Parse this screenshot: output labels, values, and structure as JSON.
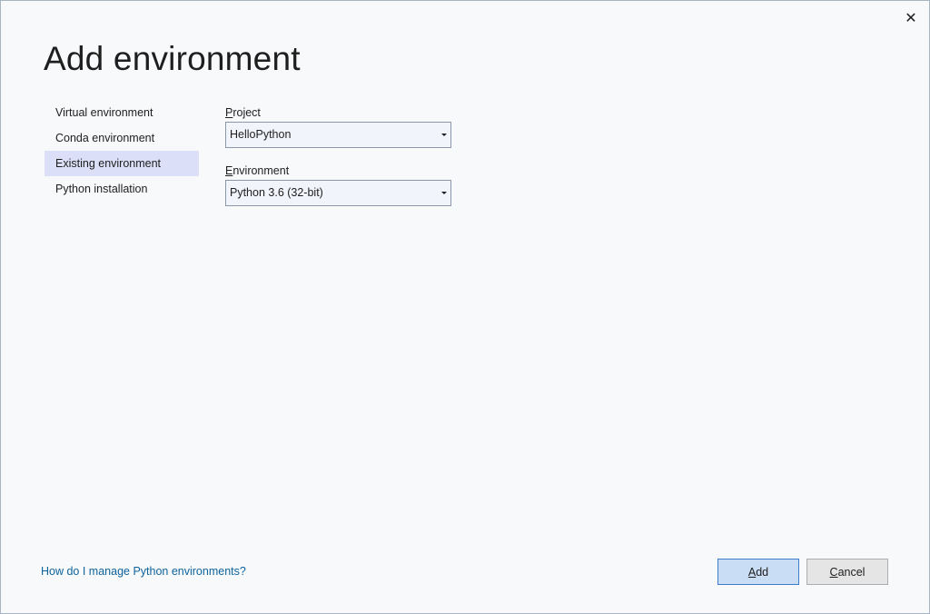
{
  "dialog": {
    "title": "Add environment",
    "close_glyph": "✕"
  },
  "nav": {
    "items": [
      {
        "label": "Virtual environment",
        "selected": false
      },
      {
        "label": "Conda environment",
        "selected": false
      },
      {
        "label": "Existing environment",
        "selected": true
      },
      {
        "label": "Python installation",
        "selected": false
      }
    ]
  },
  "form": {
    "project": {
      "label_mnemonic": "P",
      "label_rest": "roject",
      "value": "HelloPython"
    },
    "environment": {
      "label_mnemonic": "E",
      "label_rest": "nvironment",
      "value": "Python 3.6 (32-bit)"
    }
  },
  "footer": {
    "help_link": "How do I manage Python environments?",
    "add_mnemonic": "A",
    "add_rest": "dd",
    "cancel_mnemonic": "C",
    "cancel_rest": "ancel"
  },
  "colors": {
    "selected_nav_bg": "#dbdff7",
    "link": "#0e639c",
    "primary_button_bg": "#c9def5",
    "primary_button_border": "#3d7cc9"
  }
}
